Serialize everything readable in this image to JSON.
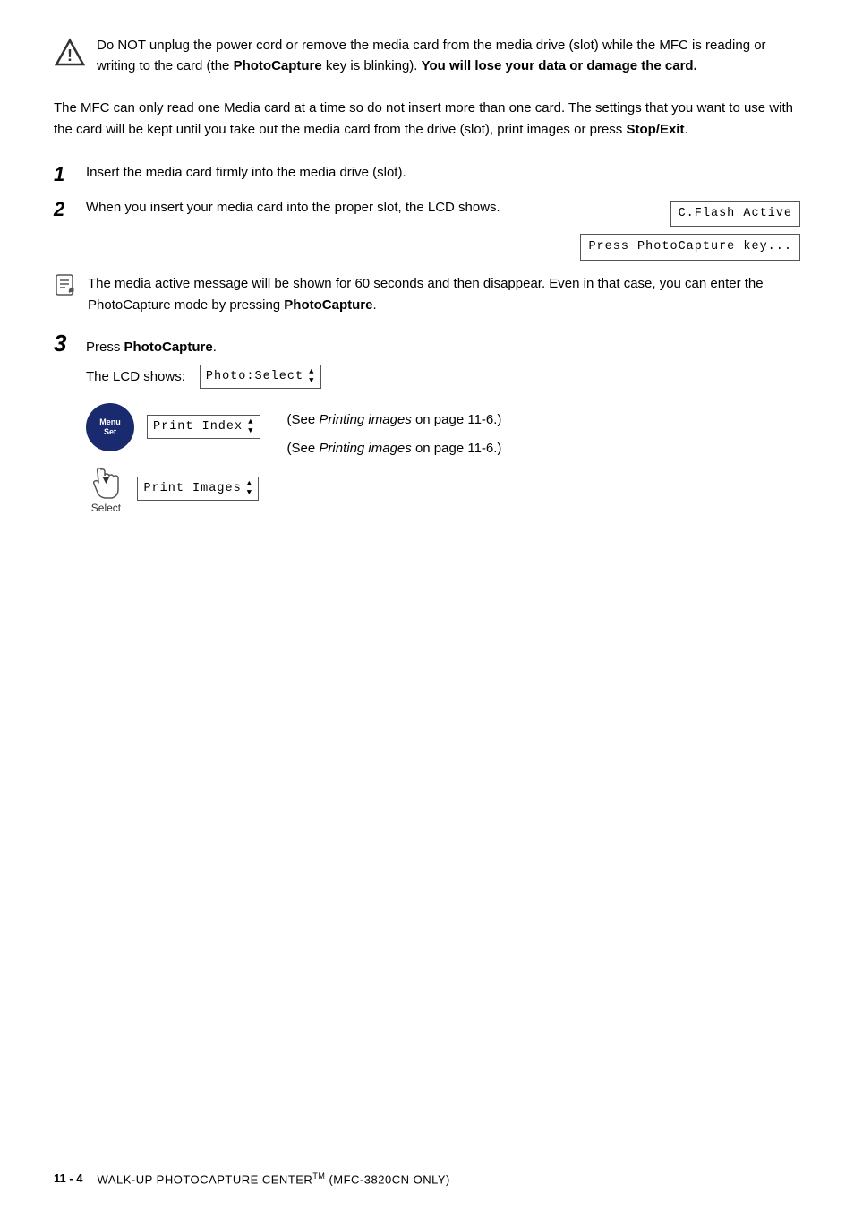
{
  "warning": {
    "text_1": "Do NOT unplug the power cord or remove the media card from the media drive (slot) while the MFC is reading or writing to the card (the ",
    "bold_1": "PhotoCapture",
    "text_2": " key is blinking). ",
    "bold_2": "You will lose your data or damage the card."
  },
  "body_para": "The MFC can only read one Media card at a time so do not insert more than one card. The settings that you want to use with the card will be kept until you take out the media card from the drive (slot), print images or press ",
  "body_para_bold": "Stop/Exit",
  "body_para_end": ".",
  "steps": {
    "step1": {
      "number": "1",
      "text": "Insert the media card firmly into the media drive (slot)."
    },
    "step2": {
      "number": "2",
      "text_1": "When you insert your media card into the proper slot, the LCD shows.",
      "lcd_1": "C.Flash Active",
      "lcd_2": "Press PhotoCapture key..."
    },
    "note": {
      "text": "The media active message will be shown for 60 seconds and then disappear. Even in that case, you can enter the PhotoCapture mode by pressing ",
      "bold": "PhotoCapture",
      "end": "."
    },
    "step3": {
      "number": "3",
      "text_1": "Press ",
      "bold": "PhotoCapture",
      "text_2": ".",
      "lcd_label": "The LCD shows:",
      "lcd_value": "Photo:Select",
      "diagram": {
        "menu_line1": "Menu",
        "menu_line2": "Set",
        "select_arrow": "▼",
        "select_label": "Select",
        "lcd_index": "Print Index",
        "lcd_images": "Print Images",
        "note1_italic": "Printing images",
        "note1_text": " on page 11-6.)",
        "note1_prefix": "(See ",
        "note2_italic": "Printing images",
        "note2_text": " on page 11-6.)",
        "note2_prefix": "(See "
      }
    }
  },
  "footer": {
    "page": "11 - 4",
    "title": "WALK-UP PHOTOCAPTURE CENTER",
    "tm": "TM",
    "subtitle": "(MFC-3820CN ONLY)"
  }
}
